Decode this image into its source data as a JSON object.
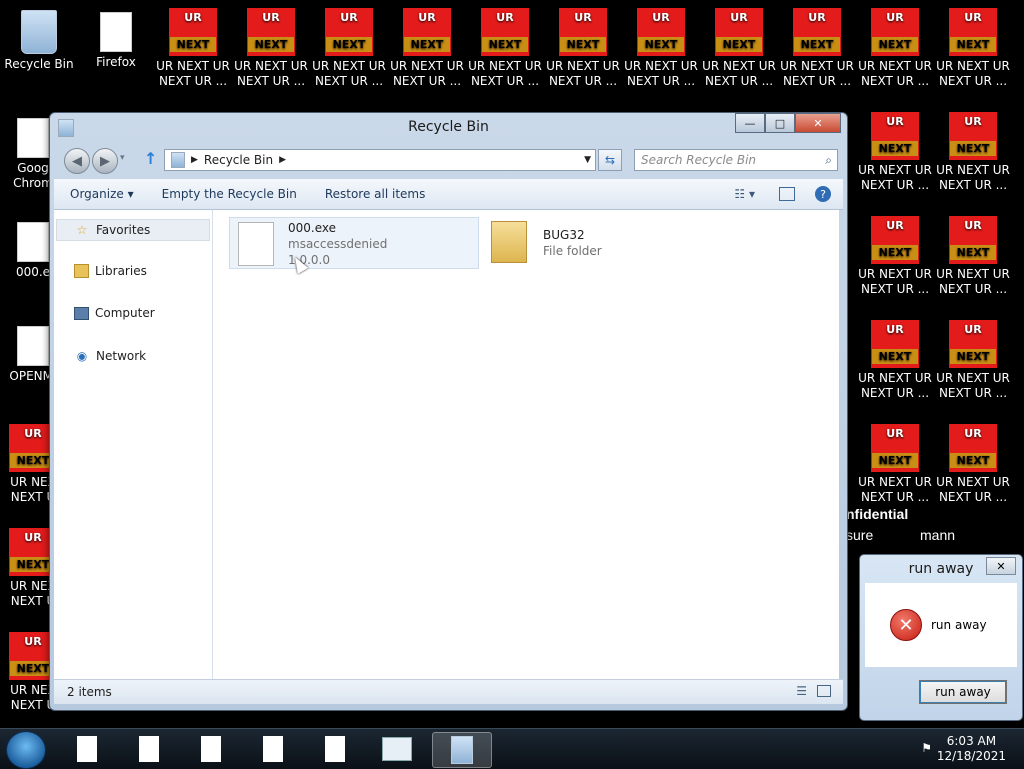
{
  "desktop": {
    "icons_left": [
      {
        "label": "Recycle Bin"
      },
      {
        "label": "Goog Chrom"
      },
      {
        "label": "000.e"
      },
      {
        "label": "OPENMI"
      },
      {
        "label": "UR NEX NEXT U"
      },
      {
        "label": "UR NEX NEXT U"
      },
      {
        "label": "UR NEX NEXT U"
      }
    ],
    "firefox_label": "Firefox",
    "urnext_icon_label": "UR NEXT UR NEXT UR ...",
    "urnext_text_top": "UR",
    "urnext_text_bottom": "NEXT",
    "confidential_text": "nfidential",
    "sure_text": "sure",
    "mann_text": "mann"
  },
  "window": {
    "title": "Recycle Bin",
    "minimize": "—",
    "maximize": "□",
    "close": "✕",
    "address_path": "Recycle Bin",
    "search_placeholder": "Search Recycle Bin",
    "toolbar": {
      "organize": "Organize ▾",
      "empty": "Empty the Recycle Bin",
      "restore": "Restore all items"
    },
    "nav": {
      "favorites": "Favorites",
      "libraries": "Libraries",
      "computer": "Computer",
      "network": "Network"
    },
    "items": [
      {
        "name": "000.exe",
        "line2": "msaccessdenied",
        "line3": "1.0.0.0"
      },
      {
        "name": "BUG32",
        "line2": "File folder"
      }
    ],
    "status": "2 items"
  },
  "dialog": {
    "title": "run away",
    "message": "run away",
    "button": "run away",
    "close": "✕"
  },
  "taskbar": {
    "time": "6:03 AM",
    "date": "12/18/2021"
  }
}
